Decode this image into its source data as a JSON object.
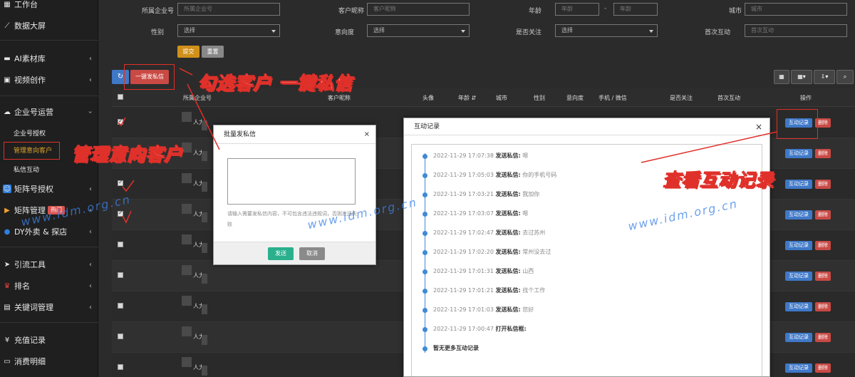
{
  "sidebar": {
    "items": [
      {
        "label": "工作台",
        "icon": "windows-icon"
      },
      {
        "label": "数据大屏",
        "icon": "chart-line-icon"
      },
      {
        "label": "AI素材库",
        "icon": "folder-icon"
      },
      {
        "label": "视频创作",
        "icon": "film-icon"
      },
      {
        "label": "企业号运营",
        "icon": "cloud-icon"
      },
      {
        "label": "矩阵号授权",
        "icon": "person-icon"
      },
      {
        "label": "矩阵管理",
        "icon": "play-icon",
        "badge": "热门"
      },
      {
        "label": "DY外卖 & 探店",
        "icon": "globe-icon"
      },
      {
        "label": "引流工具",
        "icon": "send-icon"
      },
      {
        "label": "排名",
        "icon": "trophy-icon"
      },
      {
        "label": "关键词管理",
        "icon": "document-icon"
      },
      {
        "label": "充值记录",
        "icon": "yen-icon"
      },
      {
        "label": "消费明细",
        "icon": "wallet-icon"
      }
    ],
    "subitems": [
      "企业号授权",
      "管理意向客户",
      "私信互动"
    ]
  },
  "filters": {
    "company_label": "所属企业号",
    "company_placeholder": "所属企业号",
    "nickname_label": "客户昵称",
    "nickname_placeholder": "客户昵称",
    "age_label": "年龄",
    "age_from": "年龄",
    "age_sep": "-",
    "age_to": "年龄",
    "city_label": "城市",
    "city_placeholder": "城市",
    "gender_label": "性别",
    "gender_value": "选择",
    "intent_label": "意向度",
    "intent_value": "选择",
    "follow_label": "是否关注",
    "follow_value": "选择",
    "first_label": "首次互动",
    "first_placeholder": "首次互动",
    "submit": "提交",
    "reset": "重置"
  },
  "toolbar": {
    "refresh_icon": "refresh-icon",
    "bulk_dm": "一键发私信"
  },
  "table": {
    "headers": [
      "所属企业号",
      "客户昵称",
      "头像",
      "年龄",
      "城市",
      "性别",
      "意向度",
      "手机 / 微信",
      "是否关注",
      "首次互动",
      "操作"
    ],
    "row_name": "人力",
    "rows": 9,
    "action_log": "互动记录",
    "action_delete": "删除"
  },
  "bulk_modal": {
    "title": "批量发私信",
    "hint": "请输入需要发私信内容，不可包含违法违规词，否则发送失败",
    "send": "发送",
    "cancel": "取消"
  },
  "log_modal": {
    "title": "互动记录",
    "entries": [
      {
        "time": "2022-11-29 17:07:38",
        "label": "发送私信:",
        "msg": "嗯"
      },
      {
        "time": "2022-11-29 17:05:03",
        "label": "发送私信:",
        "msg": "你的手机号码"
      },
      {
        "time": "2022-11-29 17:03:21",
        "label": "发送私信:",
        "msg": "我加你"
      },
      {
        "time": "2022-11-29 17:03:07",
        "label": "发送私信:",
        "msg": "嗯"
      },
      {
        "time": "2022-11-29 17:02:47",
        "label": "发送私信:",
        "msg": "去过苏州"
      },
      {
        "time": "2022-11-29 17:02:20",
        "label": "发送私信:",
        "msg": "常州没去过"
      },
      {
        "time": "2022-11-29 17:01:31",
        "label": "发送私信:",
        "msg": "山西"
      },
      {
        "time": "2022-11-29 17:01:21",
        "label": "发送私信:",
        "msg": "找个工作"
      },
      {
        "time": "2022-11-29 17:01:03",
        "label": "发送私信:",
        "msg": "您好"
      },
      {
        "time": "2022-11-29 17:00:47",
        "label": "打开私信框:",
        "msg": ""
      }
    ],
    "end": "暂无更多互动记录"
  },
  "annotations": {
    "select_bulk": "勾选客户 一键私信",
    "manage": "管理意向客户",
    "view_log": "查看互动记录",
    "watermark": "www.idm.org.cn"
  },
  "colors": {
    "accent": "#e0a32a",
    "annotation": "#e0302a",
    "primary": "#3f78c7",
    "danger": "#c94a45",
    "success": "#2bb08d"
  }
}
